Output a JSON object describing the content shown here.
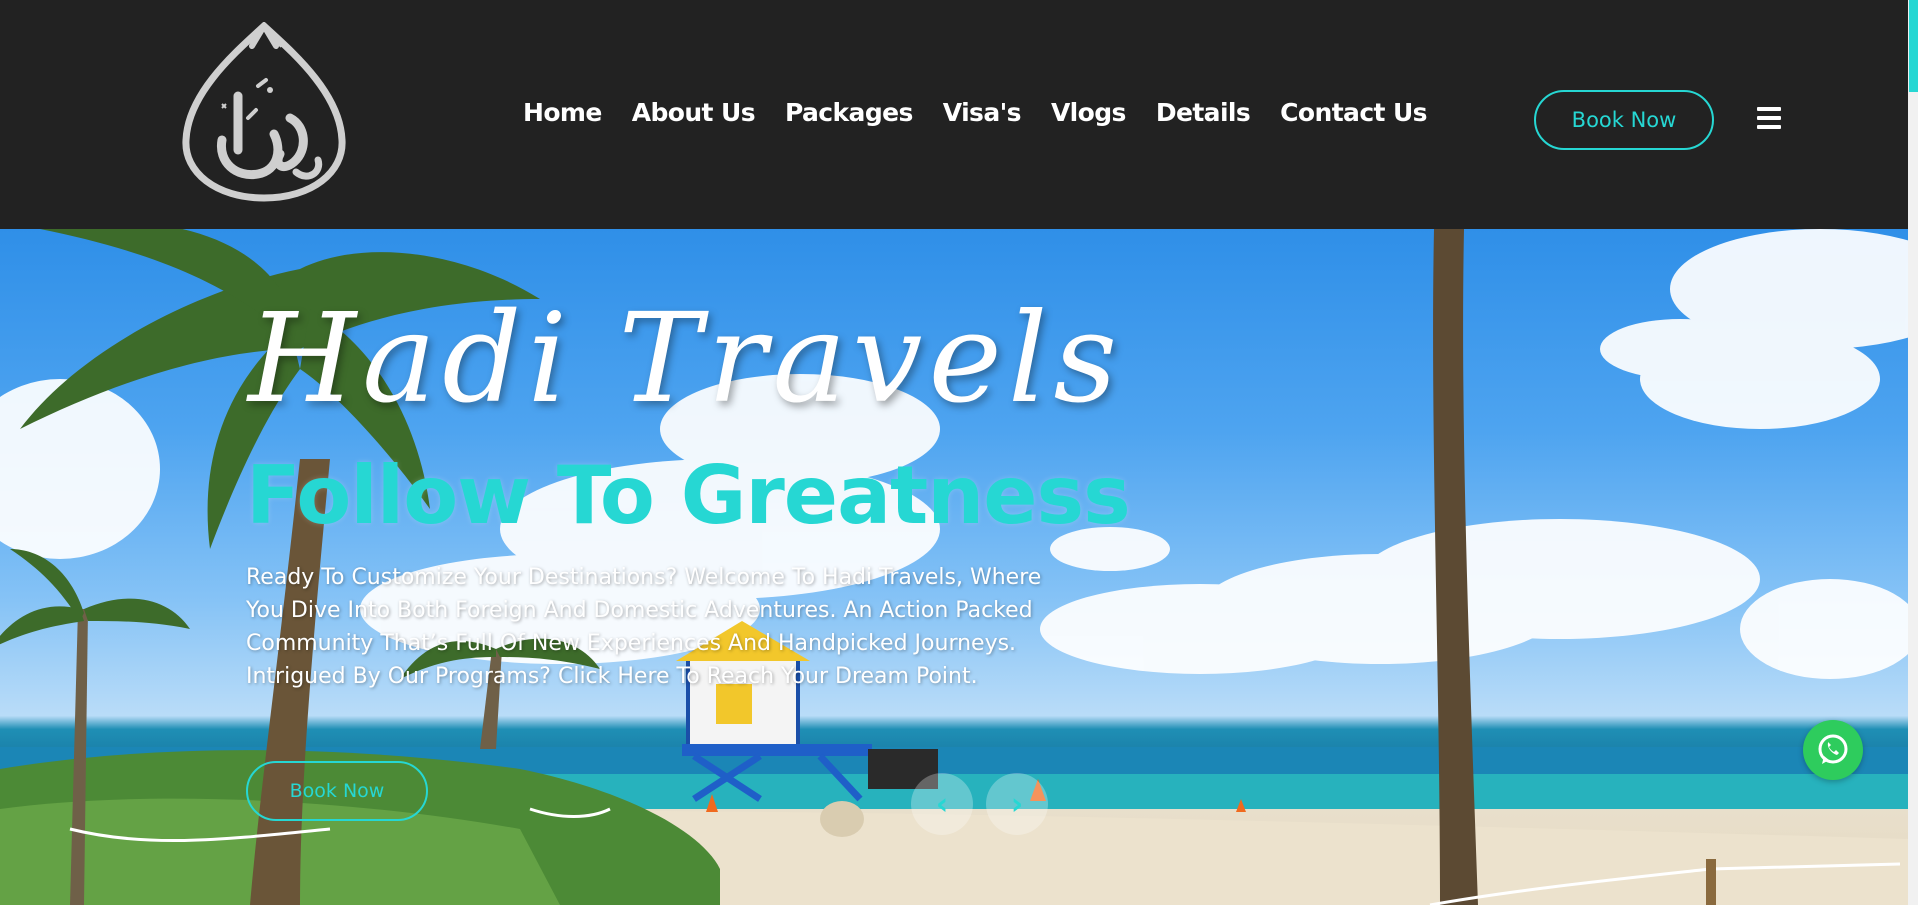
{
  "header": {
    "logo_alt": "Hadi Travels logo",
    "nav": [
      {
        "label": "Home"
      },
      {
        "label": "About Us"
      },
      {
        "label": "Packages"
      },
      {
        "label": "Visa's"
      },
      {
        "label": "Vlogs"
      },
      {
        "label": "Details"
      },
      {
        "label": "Contact Us"
      }
    ],
    "book_now_label": "Book Now",
    "menu_icon": "hamburger-menu-icon"
  },
  "hero": {
    "script_title": "Hadi Travels",
    "tagline": "Follow To Greatness",
    "description": "Ready To Customize Your Destinations? Welcome To Hadi Travels, Where You Dive Into Both Foreign And Domestic Adventures. An Action Packed Community That’s Full Of New Experiences And Handpicked Journeys. Intrigued By Our Programs? Click Here To Reach Your Dream Point.",
    "book_now_label": "Book Now",
    "prev_icon": "chevron-left-icon",
    "next_icon": "chevron-right-icon",
    "prev_glyph": "‹",
    "next_glyph": "›"
  },
  "floating": {
    "whatsapp_icon": "whatsapp-icon"
  },
  "colors": {
    "accent": "#26d7d3",
    "header_bg": "#222222",
    "whatsapp": "#2ecc5d"
  }
}
